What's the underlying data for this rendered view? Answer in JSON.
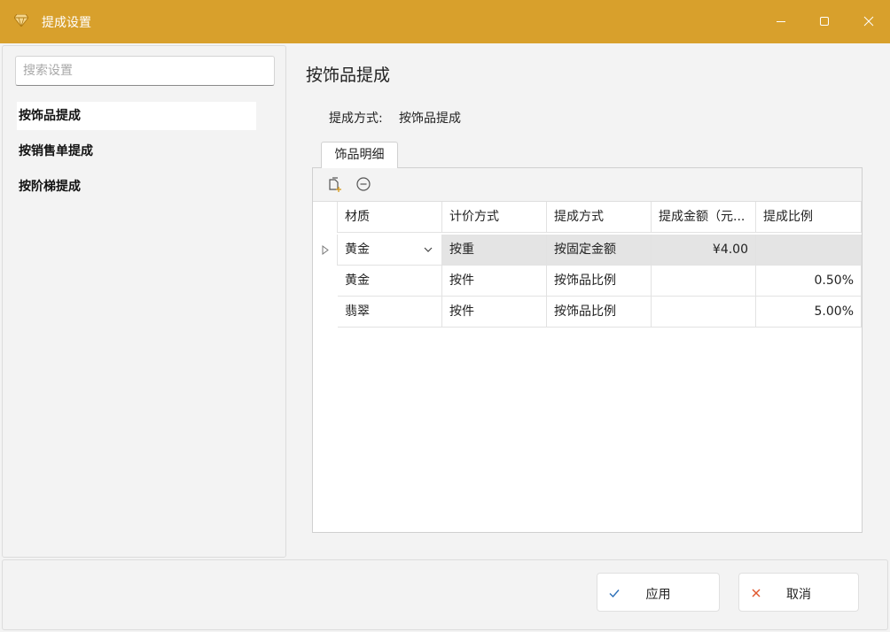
{
  "window": {
    "title": "提成设置",
    "accent": "#d8a02c"
  },
  "search": {
    "placeholder": "搜索设置",
    "value": ""
  },
  "sidebar": {
    "items": [
      {
        "label": "按饰品提成",
        "active": true
      },
      {
        "label": "按销售单提成",
        "active": false
      },
      {
        "label": "按阶梯提成",
        "active": false
      }
    ]
  },
  "main": {
    "title": "按饰品提成",
    "mode_label": "提成方式:",
    "mode_value": "按饰品提成",
    "tab_label": "饰品明细",
    "toolbar": {
      "add_icon": "add-row-icon",
      "remove_icon": "remove-row-icon"
    }
  },
  "grid": {
    "columns": [
      "材质",
      "计价方式",
      "提成方式",
      "提成金额（元...",
      "提成比例"
    ],
    "rows": [
      {
        "material": "黄金",
        "pricing": "按重",
        "method": "按固定金额",
        "amount": "¥4.00",
        "ratio": ""
      },
      {
        "material": "黄金",
        "pricing": "按件",
        "method": "按饰品比例",
        "amount": "",
        "ratio": "0.50%"
      },
      {
        "material": "翡翠",
        "pricing": "按件",
        "method": "按饰品比例",
        "amount": "",
        "ratio": "5.00%"
      }
    ]
  },
  "footer": {
    "apply_label": "应用",
    "cancel_label": "取消",
    "apply_icon_color": "#2a6fb8",
    "cancel_icon_color": "#e0562c"
  }
}
